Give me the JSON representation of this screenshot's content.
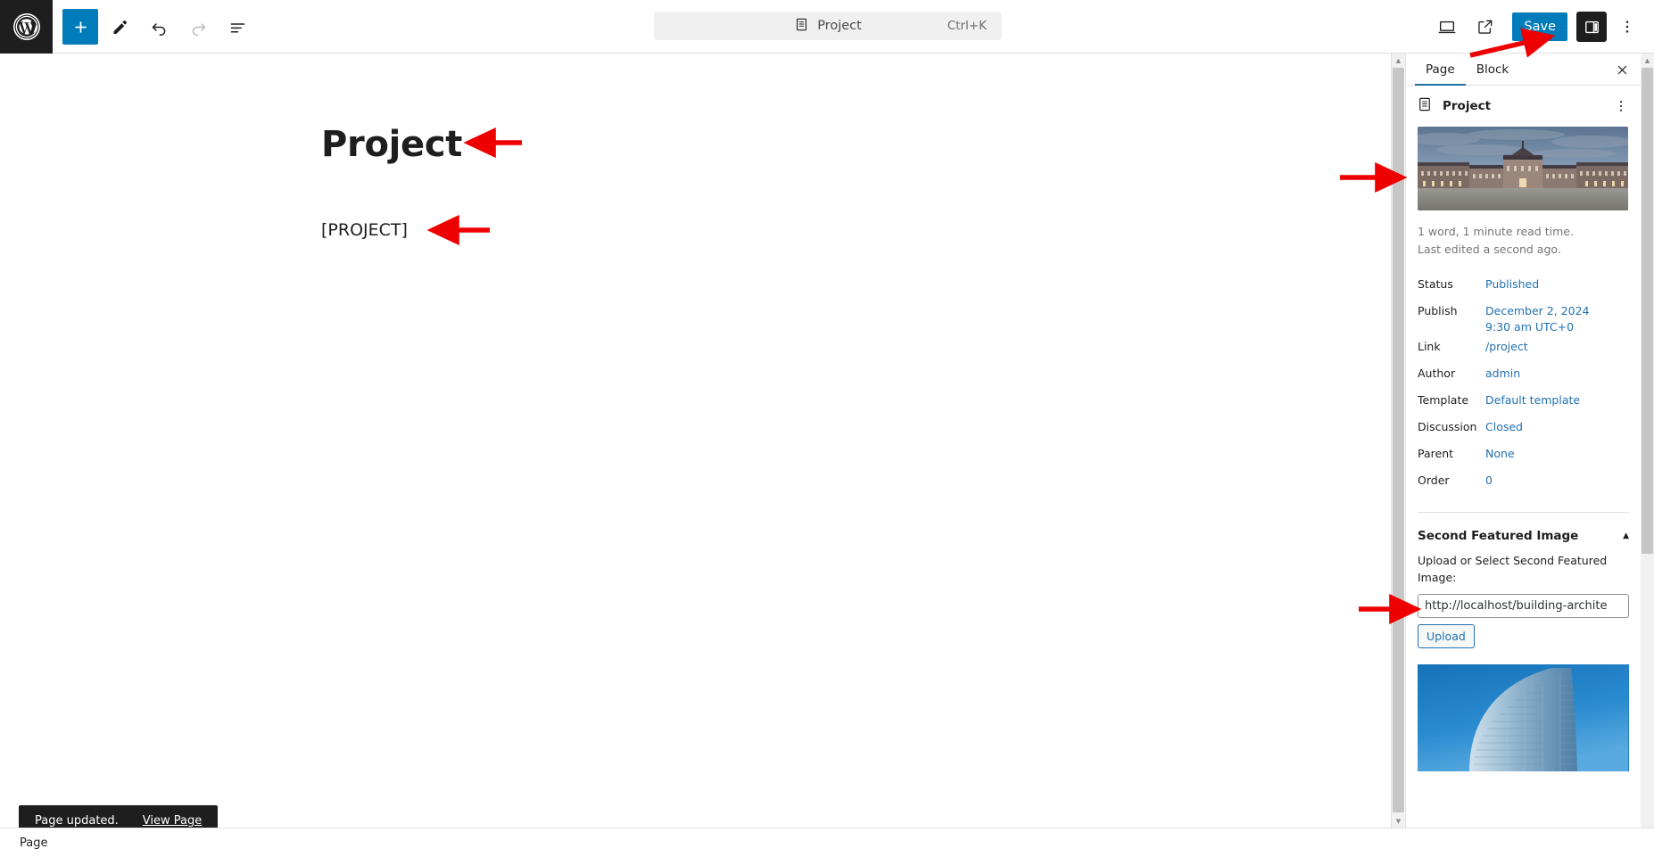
{
  "topbar": {
    "logo_icon": "wordpress-logo-icon",
    "tools": [
      {
        "name": "block-inserter",
        "icon": "plus-icon",
        "state": "primary"
      },
      {
        "name": "tools-edit",
        "icon": "pencil-icon",
        "state": "default"
      },
      {
        "name": "undo",
        "icon": "undo-arrow-icon",
        "state": "default"
      },
      {
        "name": "redo",
        "icon": "redo-arrow-icon",
        "state": "disabled"
      },
      {
        "name": "document-overview",
        "icon": "list-view-icon",
        "state": "default"
      }
    ],
    "command_center": {
      "icon": "page-document-icon",
      "label": "Project",
      "shortcut": "Ctrl+K"
    },
    "right": {
      "preview_icon": "desktop-preview-icon",
      "view_icon": "external-link-icon",
      "save_label": "Save",
      "settings_icon": "sidebar-panel-icon",
      "options_icon": "kebab-menu-icon"
    }
  },
  "canvas": {
    "title": "Project",
    "paragraph": "[PROJECT]"
  },
  "sidebar": {
    "tabs": [
      {
        "label": "Page",
        "active": true
      },
      {
        "label": "Block",
        "active": false
      }
    ],
    "close_icon": "close-icon",
    "post_type": {
      "icon": "page-document-icon",
      "label": "Project",
      "actions_icon": "kebab-menu-icon"
    },
    "featured_image_alt": "Baroque palace courtyard at dusk",
    "read_time": "1 word, 1 minute read time.",
    "last_edited": "Last edited a second ago.",
    "meta": [
      {
        "key": "Status",
        "value": "Published"
      },
      {
        "key": "Publish",
        "value": "December 2, 2024 9:30 am UTC+0"
      },
      {
        "key": "Link",
        "value": "/project"
      },
      {
        "key": "Author",
        "value": "admin"
      },
      {
        "key": "Template",
        "value": "Default template"
      },
      {
        "key": "Discussion",
        "value": "Closed"
      },
      {
        "key": "Parent",
        "value": "None"
      },
      {
        "key": "Order",
        "value": "0"
      }
    ],
    "second_featured_image": {
      "title": "Second Featured Image",
      "collapse_icon": "chevron-up-icon",
      "field_label": "Upload or Select Second Featured Image:",
      "input_value": "http://localhost/building-archite",
      "input_placeholder": "",
      "upload_label": "Upload",
      "preview_alt": "Modern curved glass skyscraper against blue sky"
    }
  },
  "snackbar": {
    "message": "Page updated.",
    "action_label": "View Page"
  },
  "bottombar": {
    "label": "Page"
  },
  "colors": {
    "accent": "#007cba",
    "link": "#2271b1",
    "dark": "#1e1e1e",
    "annotation": "#ee0000"
  },
  "annotations": [
    {
      "name": "arrow-to-save-button",
      "points_to": "Save"
    },
    {
      "name": "arrow-to-post-title",
      "points_to": "Project"
    },
    {
      "name": "arrow-to-paragraph",
      "points_to": "[PROJECT]"
    },
    {
      "name": "arrow-to-featured-image",
      "points_to": "Featured image"
    },
    {
      "name": "arrow-to-second-featured-image",
      "points_to": "Second Featured Image"
    }
  ]
}
